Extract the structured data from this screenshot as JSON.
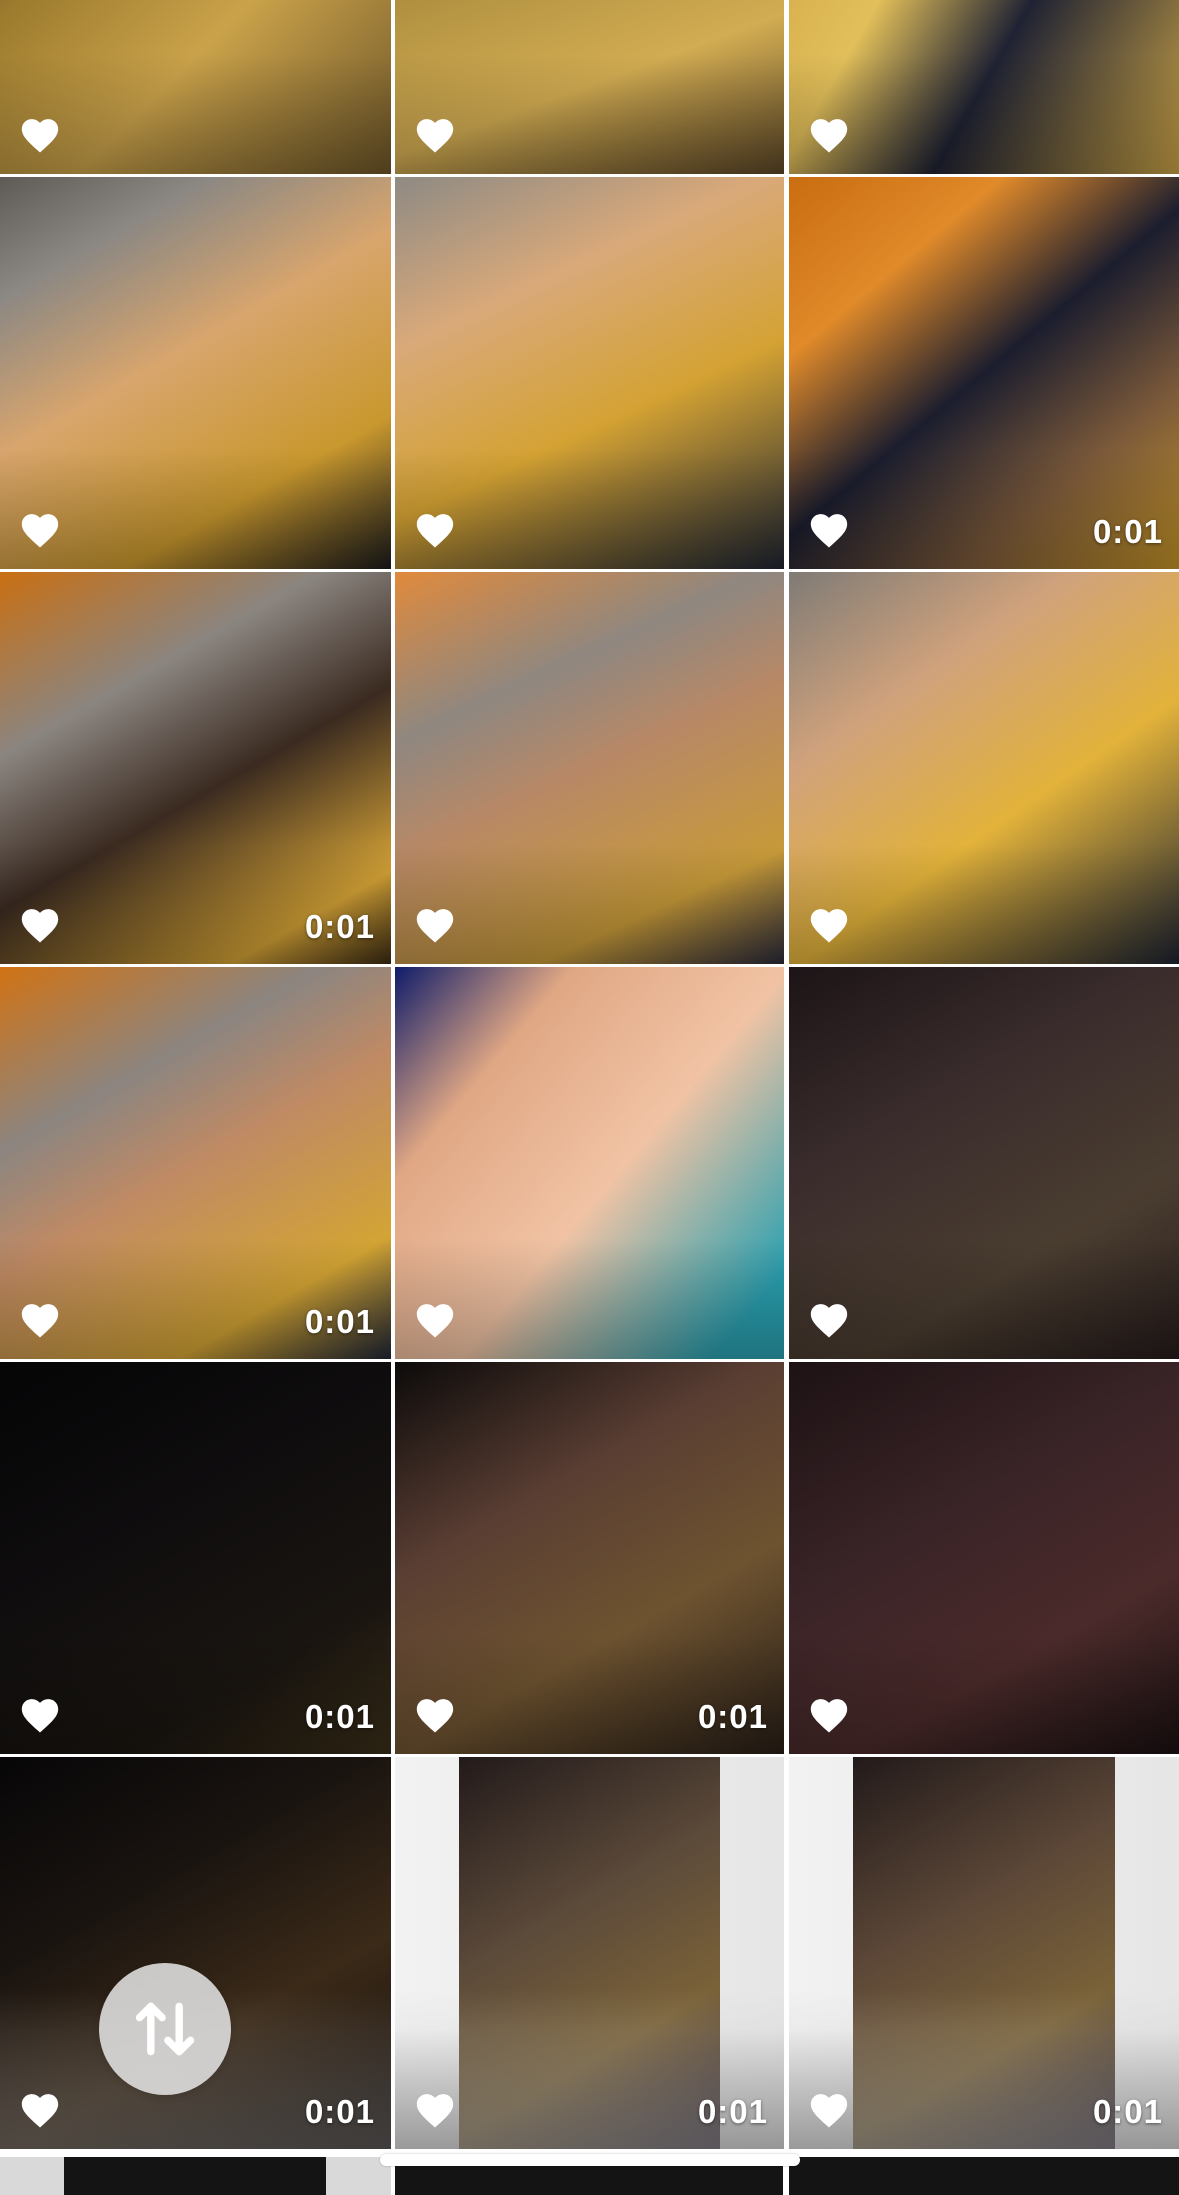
{
  "gallery": {
    "tiles": [
      {
        "duration": "",
        "liked": true,
        "bg": "linear-gradient(135deg,#3a2a22 0%,#9c7b2e 30%,#caa24a 60%,#6b5428 100%)"
      },
      {
        "duration": "",
        "liked": true,
        "bg": "linear-gradient(160deg,#7a6a55 0%,#a88a3c 35%,#d2ac52 70%,#5a4526 100%)"
      },
      {
        "duration": "",
        "liked": true,
        "bg": "linear-gradient(120deg,#caa040 0%,#e2bf5a 35%,#1f2233 60%,#c9a246 100%)"
      },
      {
        "duration": "",
        "liked": true,
        "bg": "linear-gradient(150deg,#5e5b57 0%,#8c8883 20%,#d8a56d 45%,#c9982e 75%,#1b1b1b 100%)"
      },
      {
        "duration": "",
        "liked": true,
        "bg": "linear-gradient(155deg,#8e8a84 0%,#d9a97a 30%,#d4a233 60%,#1d2432 100%)"
      },
      {
        "duration": "0:01",
        "liked": true,
        "bg": "linear-gradient(140deg,#c96d10 0%,#e08a2a 25%,#1b1d2e 50%,#7c5a3a 75%,#c39227 100%)"
      },
      {
        "duration": "0:01",
        "liked": true,
        "bg": "linear-gradient(150deg,#c96f12 0%,#8b8580 30%,#3a2a20 55%,#d4a236 85%,#3a2a12 100%)"
      },
      {
        "duration": "",
        "liked": true,
        "bg": "linear-gradient(155deg,#e08a3c 0%,#8f8780 30%,#b88866 50%,#c79a39 80%,#2a2a3a 100%)"
      },
      {
        "duration": "",
        "liked": true,
        "bg": "linear-gradient(145deg,#7f7b76 0%,#d0a27c 30%,#e2b23a 60%,#1c2230 100%)"
      },
      {
        "duration": "0:01",
        "liked": true,
        "bg": "linear-gradient(150deg,#d17314 0%,#8c8580 30%,#c08a64 50%,#d3a434 80%,#1f2635 100%)"
      },
      {
        "duration": "",
        "liked": true,
        "bg": "linear-gradient(130deg,#0f1c6a 0%,#e0a784 25%,#f1c3a4 55%,#2aa0b0 90%)"
      },
      {
        "duration": "",
        "liked": true,
        "bg": "linear-gradient(150deg,#1c1416 0%,#3a2c2c 35%,#4a3d30 70%,#251b1b 100%)"
      },
      {
        "duration": "0:01",
        "liked": true,
        "bg": "linear-gradient(150deg,#050506 0%,#0f0d0e 40%,#1a1510 75%,#3a2e18 100%)"
      },
      {
        "duration": "0:01",
        "liked": true,
        "bg": "linear-gradient(150deg,#0c0a0a 0%,#5a3e33 35%,#6e5330 65%,#281e16 100%)"
      },
      {
        "duration": "",
        "liked": true,
        "bg": "linear-gradient(150deg,#1d1214 0%,#3a2427 40%,#4b2a2a 70%,#1a1011 100%)"
      },
      {
        "duration": "0:01",
        "liked": true,
        "bg": "linear-gradient(150deg,#070608 0%,#1a1410 35%,#3b2a18 65%,#120c0a 100%)"
      },
      {
        "duration": "0:01",
        "liked": true,
        "inner": true,
        "bg": "linear-gradient(150deg,#221a1a 0%,#5c4a3a 40%,#7a6238 70%,#2a2030 100%)"
      },
      {
        "duration": "0:01",
        "liked": true,
        "inner": true,
        "bg": "linear-gradient(150deg,#221a1a 0%,#5d4838 40%,#7a6238 70%,#2a2030 100%)"
      }
    ]
  },
  "controls": {
    "sort_icon": "swap-vertical-arrows-icon"
  },
  "system": {
    "home_indicator": "home-indicator"
  }
}
